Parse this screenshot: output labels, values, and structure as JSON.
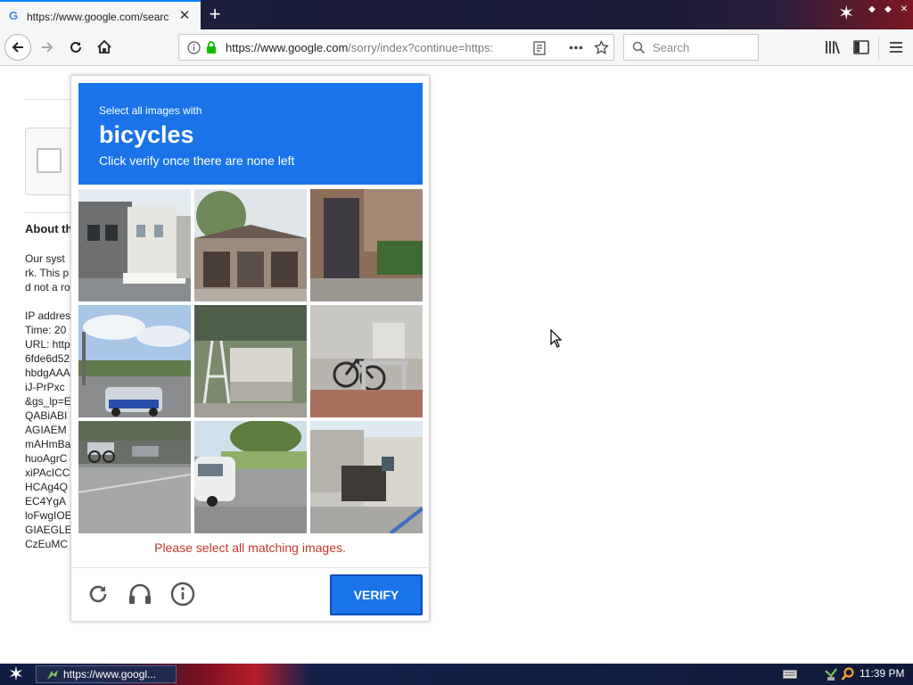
{
  "browser": {
    "tab_title": "https://www.google.com/search?",
    "tab_favicon": "G",
    "url_host": "https://www.google.com",
    "url_rest": "/sorry/index?continue=https:",
    "search_placeholder": "Search"
  },
  "background_page": {
    "heading": "About th",
    "lines_a": [
      "Our syst",
      "rk. This p",
      "d not a ro"
    ],
    "lines_b": [
      "IP addres",
      "Time: 20",
      "URL: http",
      "6fde6d52",
      "hbdgAAA",
      "iJ-PrPxc",
      "&gs_lp=E",
      "QABiABI",
      "AGIAEM",
      "mAHmBa",
      "huoAgrC",
      "xiPAcICC",
      "HCAg4Q",
      "EC4YgA",
      "loFwgIOE",
      "GIAEGLE",
      "CzEuMC"
    ]
  },
  "captcha": {
    "instruction": "Select all images with",
    "object": "bicycles",
    "subtext": "Click verify once there are none left",
    "error": "Please select all matching images.",
    "verify_label": "VERIFY",
    "tiles": [
      "street-houses",
      "shop-storefront",
      "dark-doorway",
      "road-with-cars",
      "vending-area",
      "bicycle-parked",
      "parking-lot-bikes",
      "white-car-road",
      "house-garage"
    ]
  },
  "taskbar": {
    "task_label": "https://www.googl...",
    "clock": "11:39 PM"
  },
  "colors": {
    "captcha_blue": "#1a73e8",
    "error_red": "#c0392b",
    "taskbar_navy": "#101a38"
  }
}
